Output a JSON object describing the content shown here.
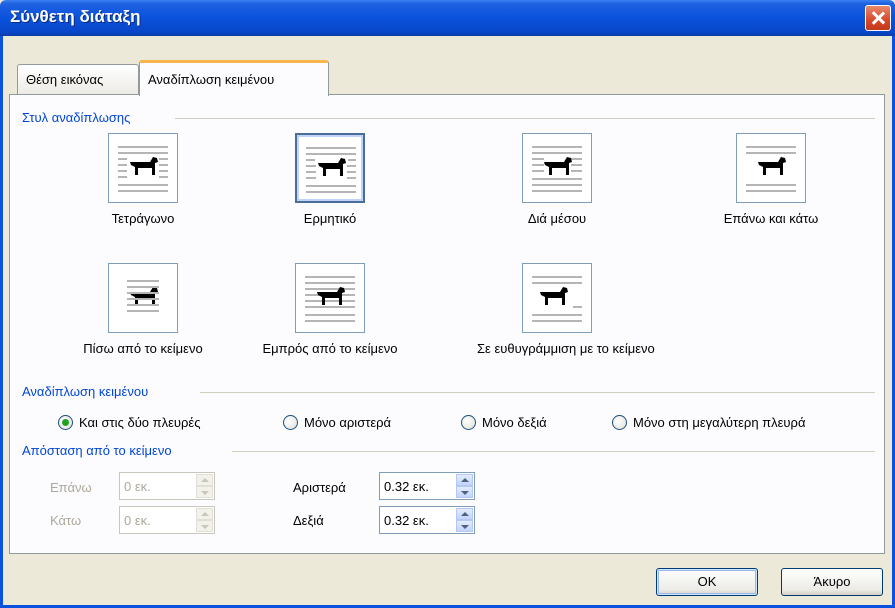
{
  "window": {
    "title": "Σύνθετη διάταξη"
  },
  "tabs": [
    {
      "label": "Θέση εικόνας"
    },
    {
      "label": "Αναδίπλωση κειμένου"
    }
  ],
  "wrap_style": {
    "group_label": "Στυλ αναδίπλωσης",
    "options": [
      {
        "label": "Τετράγωνο",
        "icon": "square-wrap-icon"
      },
      {
        "label": "Ερμητικό",
        "icon": "tight-wrap-icon",
        "selected": true
      },
      {
        "label": "Διά μέσου",
        "icon": "through-wrap-icon"
      },
      {
        "label": "Επάνω και κάτω",
        "icon": "top-bottom-wrap-icon"
      },
      {
        "label": "Πίσω από το κείμενο",
        "icon": "behind-text-icon"
      },
      {
        "label": "Εμπρός από το κείμενο",
        "icon": "in-front-of-text-icon"
      },
      {
        "label": "Σε ευθυγράμμιση με το κείμενο",
        "icon": "inline-with-text-icon"
      }
    ]
  },
  "wrap_text": {
    "group_label": "Αναδίπλωση κειμένου",
    "options": [
      {
        "label": "Και στις δύο πλευρές",
        "checked": true
      },
      {
        "label": "Μόνο αριστερά",
        "checked": false
      },
      {
        "label": "Μόνο δεξιά",
        "checked": false
      },
      {
        "label": "Μόνο στη μεγαλύτερη πλευρά",
        "checked": false
      }
    ]
  },
  "distance": {
    "group_label": "Απόσταση από το κείμενο",
    "top": {
      "label": "Επάνω",
      "value": "0 εκ."
    },
    "bottom": {
      "label": "Κάτω",
      "value": "0 εκ."
    },
    "left": {
      "label": "Αριστερά",
      "value": "0.32 εκ."
    },
    "right": {
      "label": "Δεξιά",
      "value": "0.32 εκ."
    }
  },
  "buttons": {
    "ok": "OK",
    "cancel": "Άκυρο"
  }
}
